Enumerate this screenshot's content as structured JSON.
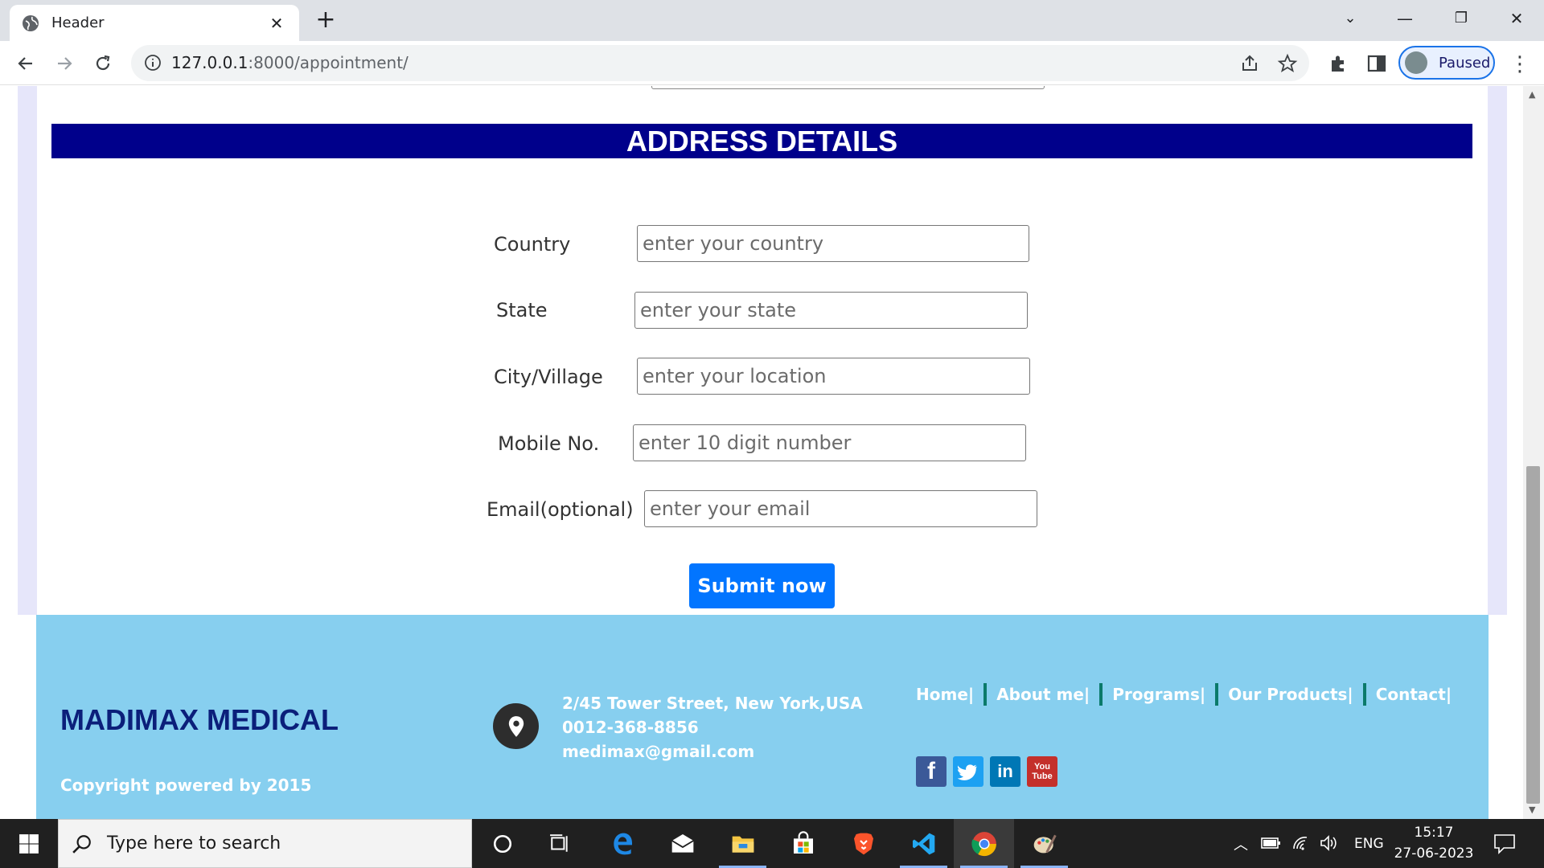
{
  "browser": {
    "tab_title": "Header",
    "url_host": "127.0.0.1",
    "url_path": ":8000/appointment/",
    "profile_label": "Paused"
  },
  "section": {
    "title": "ADDRESS DETAILS"
  },
  "form": {
    "country_label": "Country",
    "country_placeholder": "enter your country",
    "state_label": "State",
    "state_placeholder": "enter your state",
    "city_label": "City/Village",
    "city_placeholder": "enter your location",
    "mobile_label": "Mobile No.",
    "mobile_placeholder": "enter 10 digit number",
    "email_label": "Email(optional)",
    "email_placeholder": "enter your email",
    "submit_label": "Submit now"
  },
  "footer": {
    "brand": "MADIMAX MEDICAL",
    "copyright": "Copyright powered by 2015",
    "address": "2/45 Tower Street, New York,USA",
    "phone": "0012-368-8856",
    "email": "medimax@gmail.com",
    "links": [
      "Home|",
      "About me|",
      "Programs|",
      "Our Products|",
      "Contact|"
    ],
    "social": [
      "facebook",
      "twitter",
      "linkedin",
      "youtube"
    ]
  },
  "taskbar": {
    "search_placeholder": "Type here to search",
    "language": "ENG",
    "time": "15:17",
    "date": "27-06-2023"
  },
  "colors": {
    "section_header_bg": "#00008b",
    "footer_bg": "#87cfef",
    "submit_bg": "#0275ff",
    "brand_color": "#0b1f7a"
  }
}
